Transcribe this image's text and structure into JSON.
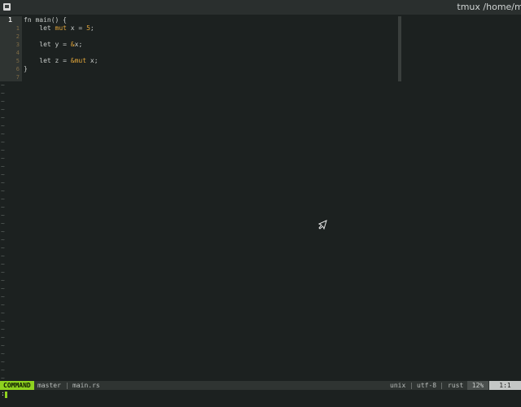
{
  "window": {
    "title": "tmux /home/mar",
    "app_icon": "terminal-icon"
  },
  "editor": {
    "line_numbers": [
      "1",
      "1",
      "2",
      "3",
      "4",
      "5",
      "6",
      "7"
    ],
    "code_lines": [
      "fn main() {",
      "    let mut x = 5;",
      "",
      "    let y = &x;",
      "",
      "    let z = &mut x;",
      "}",
      ""
    ],
    "tilde": "~",
    "tilde_count": 37
  },
  "statusline": {
    "mode": "COMMAND",
    "branch": "master",
    "separator": "|",
    "filename": "main.rs",
    "fileformat": "unix",
    "encoding": "utf-8",
    "filetype": "rust",
    "percent": "12%",
    "position": "1:1"
  },
  "cmdline": {
    "prompt": ":"
  },
  "colors": {
    "background": "#1c2120",
    "mode_accent": "#8fd21f",
    "keyword": "#e0a53a"
  }
}
